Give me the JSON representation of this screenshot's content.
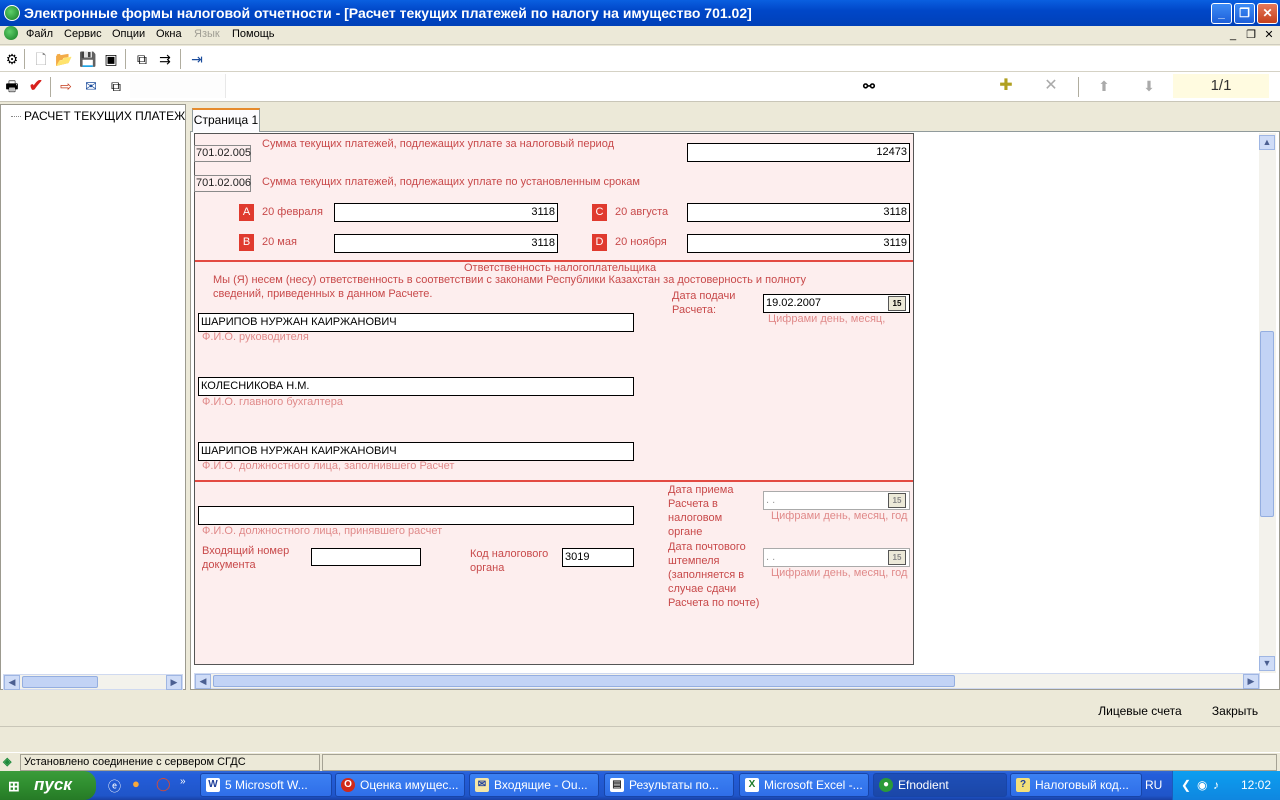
{
  "window": {
    "title": "Электронные формы налоговой отчетности - [Расчет текущих платежей по налогу на имущество 701.02]"
  },
  "menu": {
    "items": [
      "Файл",
      "Сервис",
      "Опции",
      "Окна",
      "Язык",
      "Помощь"
    ]
  },
  "toolbar": {
    "pager": "1/1"
  },
  "tree": {
    "root": "РАСЧЕТ ТЕКУЩИХ ПЛАТЕЖЕЙ"
  },
  "tabs": [
    {
      "label": "Страница 1"
    }
  ],
  "form": {
    "row005": {
      "code": "701.02.005",
      "label": "Сумма текущих платежей, подлежащих уплате за налоговый период",
      "value": "12473"
    },
    "row006": {
      "code": "701.02.006",
      "label": "Сумма текущих платежей, подлежащих уплате по установленным срокам"
    },
    "payments": [
      {
        "letter": "A",
        "label": "20 февраля",
        "value": "3118"
      },
      {
        "letter": "B",
        "label": "20 мая",
        "value": "3118"
      },
      {
        "letter": "C",
        "label": "20 августа",
        "value": "3118"
      },
      {
        "letter": "D",
        "label": "20 ноября",
        "value": "3119"
      }
    ],
    "responsibility": {
      "heading": "Ответственность налогоплательщика",
      "text1": "Мы (Я) несем (несу) ответственность в соответствии с законами Республики Казахстан за достоверность и полноту",
      "text2": "сведений, приведенных в данном Расчете.",
      "date_label1": "Дата подачи",
      "date_label2": "Расчета:",
      "date_value": "19.02.2007",
      "date_hint": "Цифрами день, месяц,",
      "head_name": "ШАРИПОВ НУРЖАН КАИРЖАНОВИЧ",
      "head_caption": "Ф.И.О. руководителя",
      "accountant_name": "КОЛЕСНИКОВА Н.М.",
      "accountant_caption": "Ф.И.О. главного бухгалтера",
      "filler_name": "ШАРИПОВ НУРЖАН КАИРЖАНОВИЧ",
      "filler_caption": "Ф.И.О. должностного лица, заполнившего Расчет"
    },
    "reception": {
      "accepted_caption": "Ф.И.О. должностного лица, принявшего расчет",
      "incoming_label1": "Входящий номер",
      "incoming_label2": "документа",
      "tax_org_label1": "Код налогового",
      "tax_org_label2": "органа",
      "tax_org_value": "3019",
      "receipt_l1": "Дата приема",
      "receipt_l2": "Расчета в",
      "receipt_l3": "налоговом",
      "receipt_l4": "органе",
      "receipt_placeholder": ". .",
      "receipt_hint": "Цифрами день, месяц, год",
      "postmark_l1": "Дата почтового",
      "postmark_l2": "штемпеля",
      "postmark_l3": "(заполняется в",
      "postmark_l4": "случае сдачи",
      "postmark_l5": "Расчета по почте)",
      "postmark_placeholder": ". .",
      "postmark_hint": "Цифрами день, месяц, год"
    }
  },
  "calendar_icon_text": "15",
  "bottom": {
    "accounts_button": "Лицевые счета",
    "close_button": "Закрыть"
  },
  "status": {
    "text": "Установлено соединение с сервером СГДС"
  },
  "taskbar": {
    "start_label": "пуск",
    "tasks": [
      "5 Microsoft W...",
      "Оценка имущес...",
      "Входящие - Ou...",
      "Результаты по...",
      "Microsoft Excel -...",
      "Efnodient",
      "Налоговый код..."
    ],
    "lang": "RU",
    "clock": "12:02"
  }
}
